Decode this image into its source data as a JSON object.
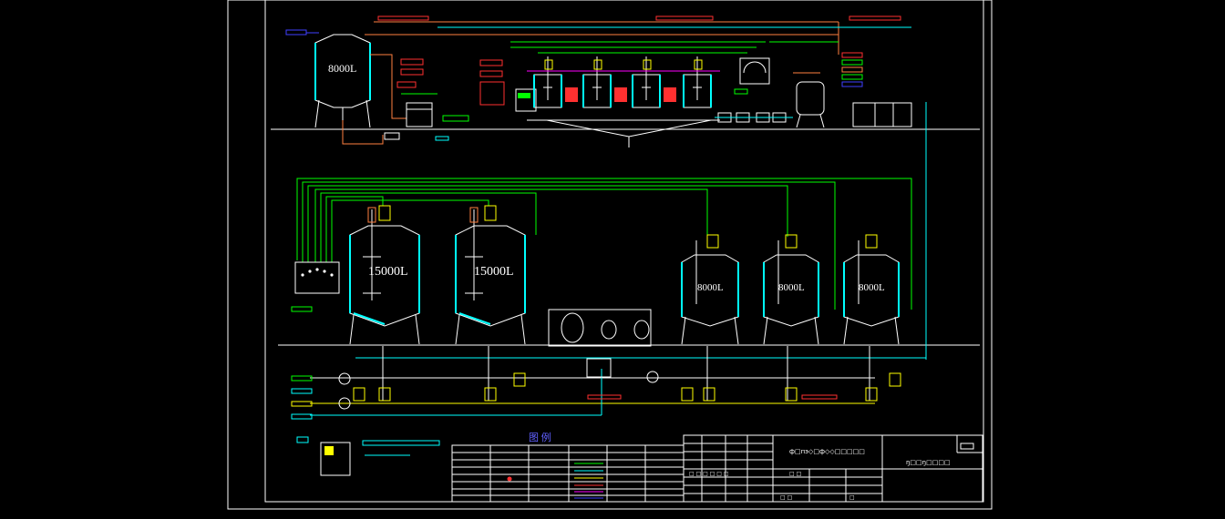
{
  "drawing": {
    "tanks": {
      "top_storage": "8000L",
      "mid_large_1": "15000L",
      "mid_large_2": "15000L",
      "mid_small_1": "8000L",
      "mid_small_2": "8000L",
      "mid_small_3": "8000L"
    },
    "legend": {
      "title": "图  例",
      "glyphs_note": "symbol legend table"
    },
    "title_block": {
      "drawing_title": "ф□пэ◇□ф◇◇□□□□□",
      "company": "ŋ□□ŋ□□□□",
      "rows": [
        "□ □ □ □ □ □",
        "□ □",
        "□ □",
        "□"
      ]
    }
  },
  "colors": {
    "background": "#000000",
    "frame": "#ffffff",
    "tank": "#ffffff",
    "jacket": "#00ffff",
    "pipe_green": "#00ff00",
    "pipe_cyan": "#00ffff",
    "pipe_red": "#ff3030",
    "pipe_yellow": "#ffff00",
    "pipe_magenta": "#ff00ff",
    "pipe_orange": "#ff8040",
    "pipe_blue": "#4040ff"
  }
}
